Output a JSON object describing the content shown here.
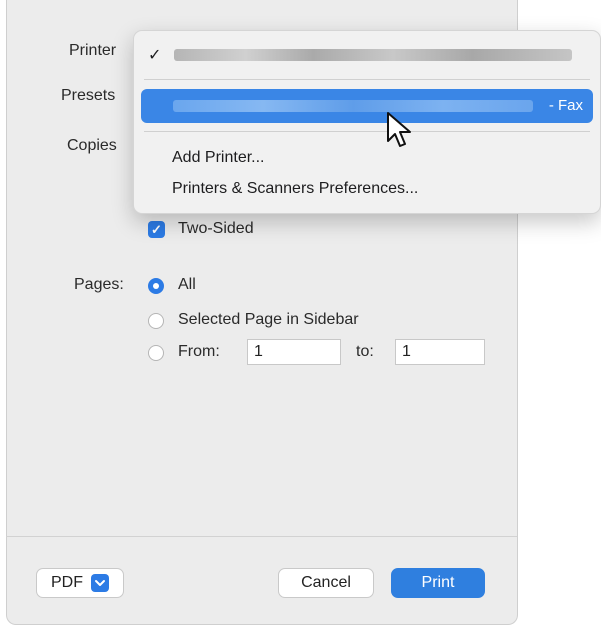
{
  "dialog": {
    "labels": {
      "printer": "Printer",
      "presets": "Presets",
      "copies": "Copies",
      "pages": "Pages:"
    },
    "two_sided": {
      "label": "Two-Sided",
      "checked": true
    },
    "pages": {
      "options": [
        "All",
        "Selected Page in Sidebar",
        "From:"
      ],
      "selected": "All",
      "from_value": "1",
      "to_label": "to:",
      "to_value": "1"
    },
    "footer": {
      "pdf_label": "PDF",
      "cancel_label": "Cancel",
      "print_label": "Print"
    }
  },
  "printer_menu": {
    "checkmark": "✓",
    "selected_printer_suffix": "- Fax",
    "items": [
      "Add Printer...",
      "Printers & Scanners Preferences..."
    ]
  },
  "colors": {
    "accent": "#2c7be5",
    "highlight": "#3a86e6",
    "primary_button": "#2f7fdf"
  }
}
